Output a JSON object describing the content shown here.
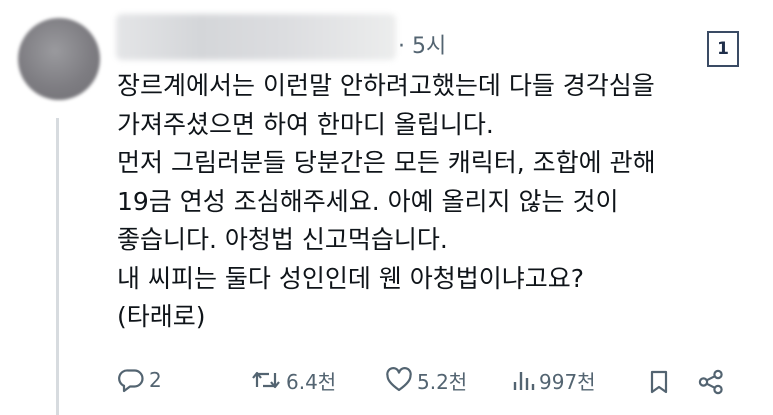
{
  "post": {
    "timestamp": "· 5시",
    "badge": "1",
    "lines": [
      "장르계에서는 이런말 안하려고했는데 다들 경각심을",
      "가져주셨으면 하여 한마디 올립니다.",
      "먼저 그림러분들 당분간은 모든 캐릭터, 조합에 관해",
      "19금 연성 조심해주세요. 아예 올리지 않는 것이",
      "좋습니다. 아청법 신고먹습니다.",
      "내 씨피는 둘다 성인인데 웬 아청법이냐고요?",
      "(타래로)"
    ]
  },
  "actions": {
    "reply": {
      "icon": "reply-icon",
      "count": "2"
    },
    "repost": {
      "icon": "repost-icon",
      "count": "6.4천"
    },
    "like": {
      "icon": "heart-icon",
      "count": "5.2천"
    },
    "views": {
      "icon": "bar-chart-icon",
      "count": "997천"
    },
    "bookmark": {
      "icon": "bookmark-icon"
    },
    "share": {
      "icon": "share-icon"
    }
  },
  "colors": {
    "text": "#0f1419",
    "muted": "#536471",
    "thread_line": "#d7dbdf"
  }
}
